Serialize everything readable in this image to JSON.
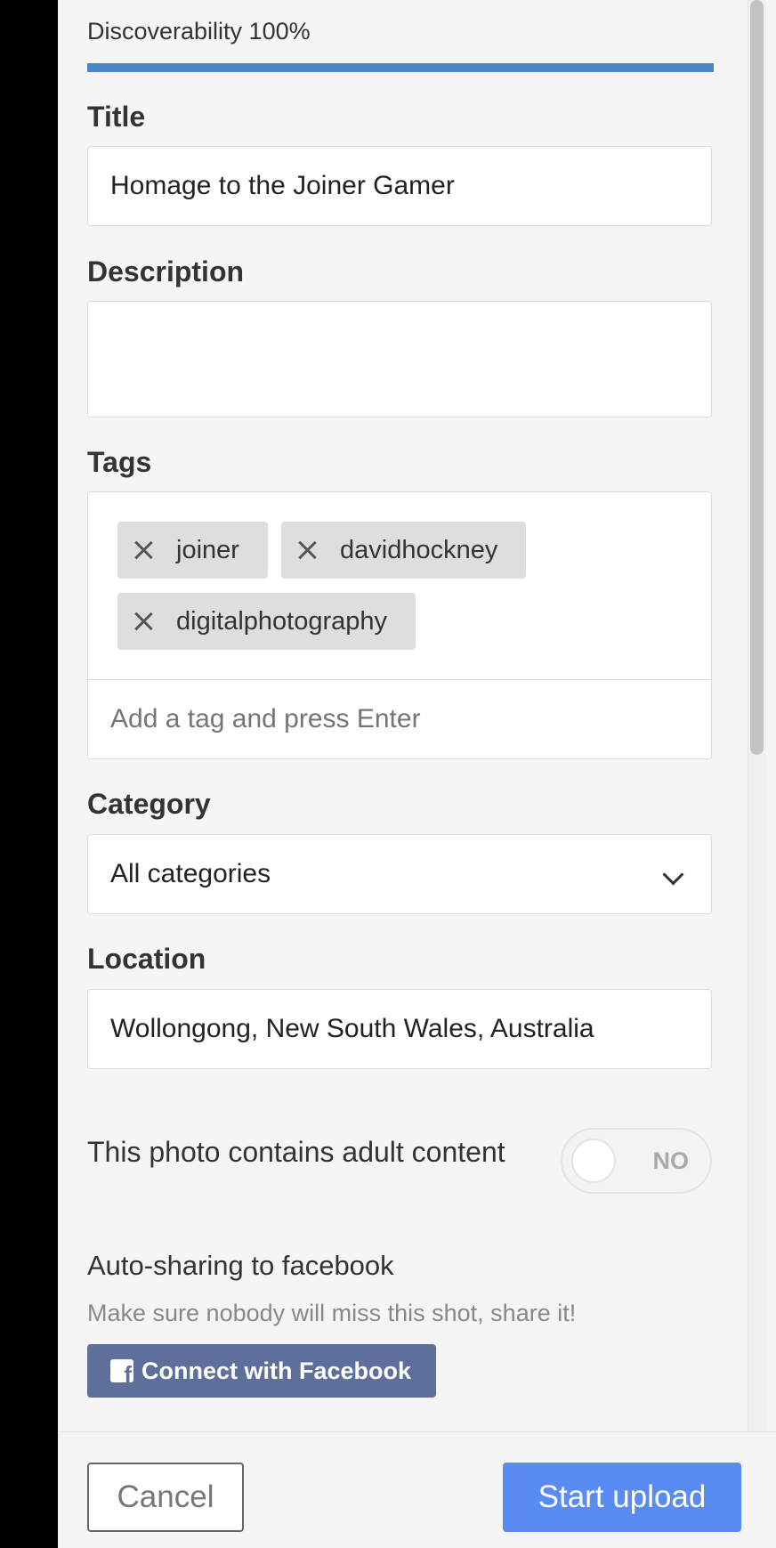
{
  "discoverability": {
    "label": "Discoverability 100%",
    "percent": 100
  },
  "fields": {
    "title": {
      "label": "Title",
      "value": "Homage to the Joiner Gamer"
    },
    "description": {
      "label": "Description",
      "value": ""
    },
    "tags": {
      "label": "Tags",
      "items": [
        "joiner",
        "davidhockney",
        "digitalphotography"
      ],
      "placeholder": "Add a tag and press Enter"
    },
    "category": {
      "label": "Category",
      "value": "All categories"
    },
    "location": {
      "label": "Location",
      "value": "Wollongong, New South Wales, Australia"
    }
  },
  "adult": {
    "label": "This photo contains adult content",
    "toggle_text": "NO"
  },
  "sharing": {
    "title": "Auto-sharing to facebook",
    "subtitle": "Make sure nobody will miss this shot, share it!",
    "button": "Connect with Facebook",
    "icon": "facebook-icon"
  },
  "footer": {
    "cancel": "Cancel",
    "start": "Start upload"
  },
  "colors": {
    "accent": "#4a86c5",
    "start_button": "#5a8bf2",
    "facebook": "#5f6f9c"
  }
}
